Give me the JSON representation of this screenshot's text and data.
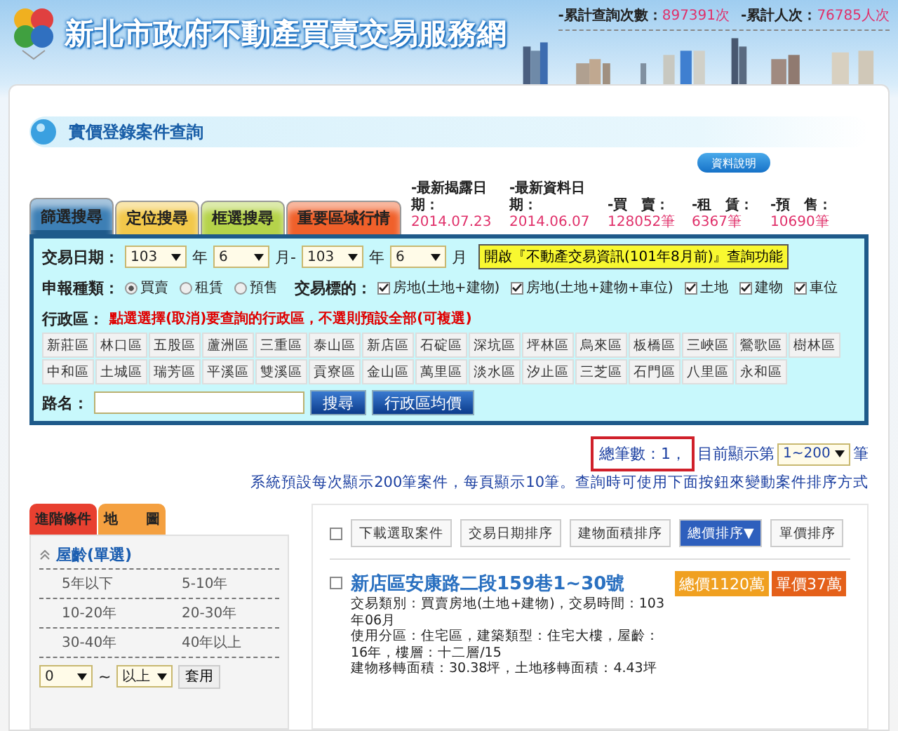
{
  "header": {
    "title": "新北市政府不動產買賣交易服務網",
    "stats": [
      {
        "label": "-累計查詢次數：",
        "value": "897391次"
      },
      {
        "label": "-累計人次：",
        "value": "76785人次"
      }
    ]
  },
  "section_title": "實價登錄案件查詢",
  "info_button": "資料說明",
  "tabs": [
    {
      "label": "篩選搜尋",
      "color": "#3d7fb5",
      "selected": true
    },
    {
      "label": "定位搜尋",
      "color": "#f2c84a",
      "selected": false
    },
    {
      "label": "框選搜尋",
      "color": "#b5d34a",
      "selected": false
    },
    {
      "label": "重要區域行情",
      "color": "#f0602a",
      "selected": false
    }
  ],
  "latest": [
    {
      "label": "-最新揭露日期：",
      "value": "2014.07.23"
    },
    {
      "label": "-最新資料日期：",
      "value": "2014.06.07"
    },
    {
      "label": "-買　賣：",
      "value": "128052筆"
    },
    {
      "label": "-租　賃：",
      "value": "6367筆"
    },
    {
      "label": "-預　售：",
      "value": "10690筆"
    }
  ],
  "search": {
    "date_label": "交易日期：",
    "date_parts": [
      {
        "kind": "select",
        "value": "103"
      },
      {
        "kind": "text",
        "text": "年"
      },
      {
        "kind": "select",
        "value": "6"
      },
      {
        "kind": "text",
        "text": "月-"
      },
      {
        "kind": "select",
        "value": "103"
      },
      {
        "kind": "text",
        "text": "年"
      },
      {
        "kind": "select",
        "value": "6"
      },
      {
        "kind": "text",
        "text": "月"
      }
    ],
    "old_data_button": "開啟『不動產交易資訊(101年8月前)』查詢功能",
    "type_label": "申報種類：",
    "types": [
      {
        "label": "買賣",
        "selected": true
      },
      {
        "label": "租賃",
        "selected": false
      },
      {
        "label": "預售",
        "selected": false
      }
    ],
    "target_label": "交易標的：",
    "targets": [
      {
        "label": "房地(土地+建物)",
        "checked": true
      },
      {
        "label": "房地(土地+建物+車位)",
        "checked": true
      },
      {
        "label": "土地",
        "checked": true
      },
      {
        "label": "建物",
        "checked": true
      },
      {
        "label": "車位",
        "checked": true
      }
    ],
    "district_label": "行政區：",
    "district_hint": "點選選擇(取消)要查詢的行政區，不選則預設全部(可複選)",
    "districts": [
      {
        "label": "新莊區",
        "selected": false
      },
      {
        "label": "林口區",
        "selected": false
      },
      {
        "label": "五股區",
        "selected": false
      },
      {
        "label": "蘆洲區",
        "selected": false
      },
      {
        "label": "三重區",
        "selected": false
      },
      {
        "label": "泰山區",
        "selected": false
      },
      {
        "label": "新店區",
        "selected": false
      },
      {
        "label": "石碇區",
        "selected": false
      },
      {
        "label": "深坑區",
        "selected": false
      },
      {
        "label": "坪林區",
        "selected": false
      },
      {
        "label": "烏來區",
        "selected": false
      },
      {
        "label": "板橋區",
        "selected": false
      },
      {
        "label": "三峽區",
        "selected": false
      },
      {
        "label": "鶯歌區",
        "selected": false
      },
      {
        "label": "樹林區",
        "selected": false
      },
      {
        "label": "中和區",
        "selected": false
      },
      {
        "label": "土城區",
        "selected": false
      },
      {
        "label": "瑞芳區",
        "selected": false
      },
      {
        "label": "平溪區",
        "selected": false
      },
      {
        "label": "雙溪區",
        "selected": false
      },
      {
        "label": "貢寮區",
        "selected": false
      },
      {
        "label": "金山區",
        "selected": false
      },
      {
        "label": "萬里區",
        "selected": false
      },
      {
        "label": "淡水區",
        "selected": false
      },
      {
        "label": "汐止區",
        "selected": false
      },
      {
        "label": "三芝區",
        "selected": false
      },
      {
        "label": "石門區",
        "selected": false
      },
      {
        "label": "八里區",
        "selected": false
      },
      {
        "label": "永和區",
        "selected": false
      }
    ],
    "road_label": "路名：",
    "buttons": [
      "搜尋",
      "行政區均價"
    ]
  },
  "results": {
    "count": "總筆數：1，",
    "showing": "目前顯示第",
    "range": "1~200",
    "unit": "筆",
    "note": "系統預設每次顯示200筆案件，每頁顯示10筆。查詢時可使用下面按鈕來變動案件排序方式"
  },
  "filter_panel": {
    "tabs": [
      {
        "label": "進階條件",
        "selected": true
      },
      {
        "label": "地　　圖",
        "selected": false
      }
    ],
    "section": {
      "title": "屋齡(單選)",
      "expanded": true,
      "options": [
        "5年以下",
        "5-10年",
        "10-20年",
        "20-30年",
        "30-40年",
        "40年以上"
      ],
      "min": "0",
      "separator": "~",
      "max": "以上",
      "apply": "套用"
    }
  },
  "case_list": {
    "select_all": false,
    "actions": [
      {
        "label": "下載選取案件",
        "selected": false
      },
      {
        "label": "交易日期排序",
        "selected": false
      },
      {
        "label": "建物面積排序",
        "selected": false
      },
      {
        "label": "總價排序▼",
        "selected": true
      },
      {
        "label": "單價排序",
        "selected": false
      }
    ],
    "cases": [
      {
        "checked": false,
        "title": "新店區安康路二段159巷1~30號",
        "details": [
          "交易類別：買賣房地(土地+建物)，交易時間：103年06月",
          "使用分區：住宅區，建築類型：住宅大樓，屋齡：16年，樓層：十二層/15",
          "建物移轉面積：30.38坪，土地移轉面積：4.43坪"
        ],
        "tags": [
          {
            "label": "總價1120萬",
            "color": "#f0a020"
          },
          {
            "label": "單價37萬",
            "color": "#e4601a"
          }
        ]
      }
    ]
  }
}
